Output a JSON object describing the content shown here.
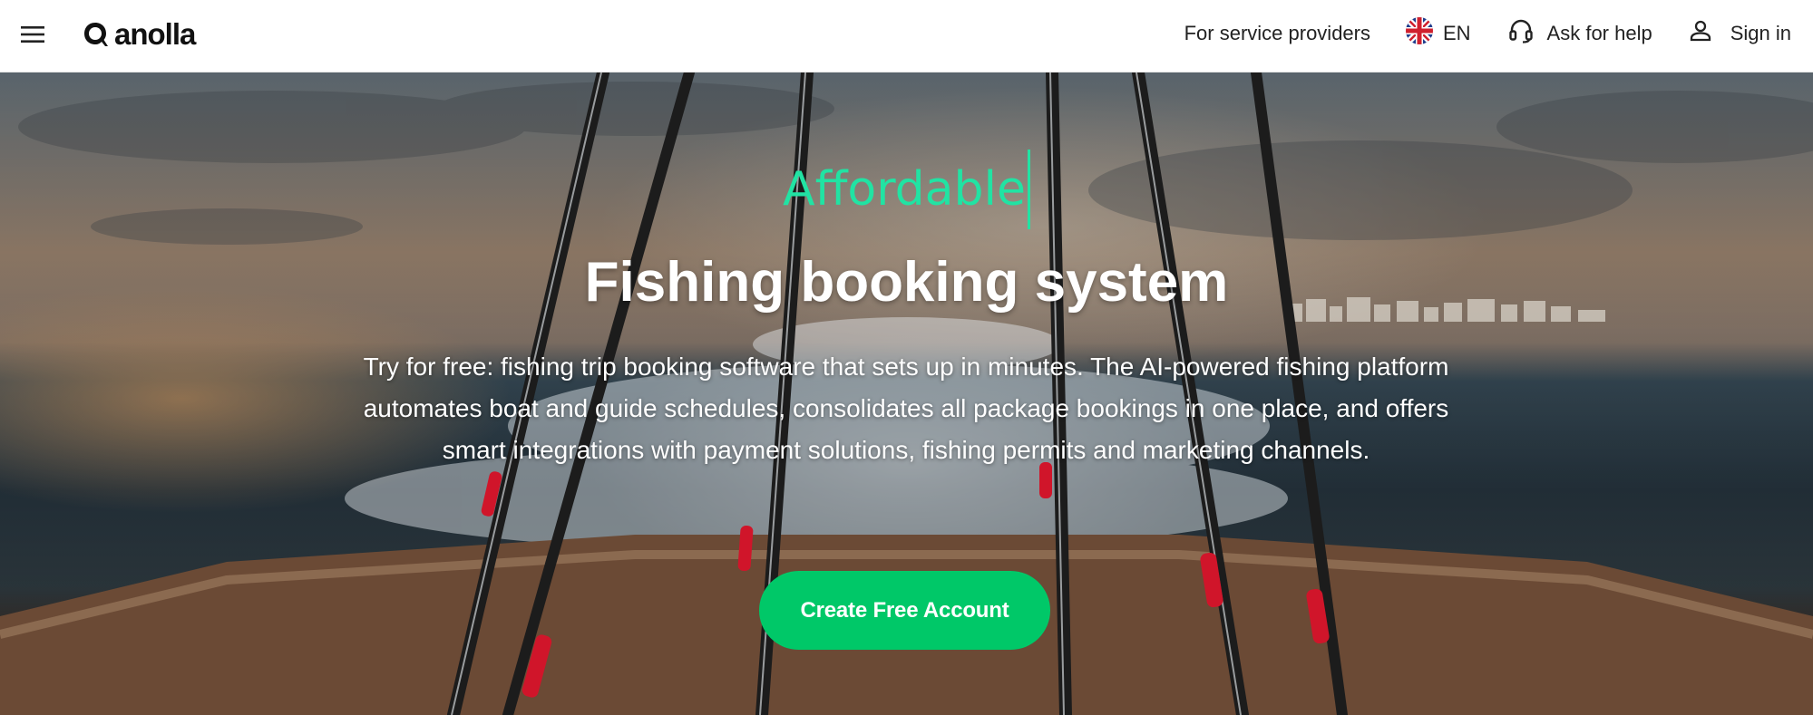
{
  "header": {
    "menu_icon": "hamburger-menu-icon",
    "logo_text": "anolla",
    "nav": {
      "providers_label": "For service providers",
      "language_label": "EN",
      "language_flag_icon": "uk-flag-icon",
      "help_label": "Ask for help",
      "help_icon": "headset-icon",
      "signin_label": "Sign in",
      "signin_icon": "user-icon"
    }
  },
  "hero": {
    "rotating_word": "Affordable",
    "title": "Fishing booking system",
    "description": "Try for free: fishing trip booking software that sets up in minutes. The AI-powered fishing platform automates boat and guide schedules, consolidates all package bookings in one place, and offers smart integrations with payment solutions, fishing permits and marketing channels.",
    "cta_label": "Create Free Account"
  },
  "colors": {
    "accent_green": "#00c868",
    "rotating_word_color": "#21e3a3",
    "header_bg": "#ffffff",
    "text_dark": "#222222"
  }
}
